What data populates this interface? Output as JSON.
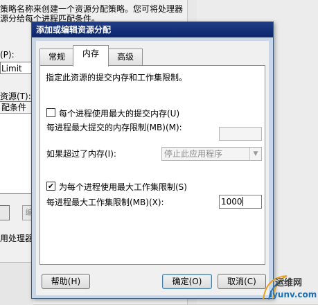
{
  "background_window": {
    "description_line1": "策略名称来创建一个资源分配策略。您可将处理器",
    "description_line2": "源分给每个进程匹配条件。",
    "field_label_fragment": "(P):",
    "field_value_fragment": "Limit",
    "resources_label_fragment": "资源(T):",
    "list_header_fragment": "配条件",
    "button_fragment": "编",
    "processor_fragment": "用处理器"
  },
  "dialog": {
    "title": "添加或编辑资源分配",
    "tabs": [
      {
        "label": "常规",
        "active": false
      },
      {
        "label": "内存",
        "active": true
      },
      {
        "label": "高级",
        "active": false
      }
    ],
    "panel": {
      "description": "指定此资源的提交内存和工作集限制。",
      "commit_memory": {
        "checkbox_label": "每个进程使用最大的提交内存(U)",
        "checked": false,
        "limit_label": "每进程最大提交的内存限制(MB)(M):",
        "limit_value": ""
      },
      "if_exceeded": {
        "label": "如果超过了内存(I):",
        "selected": "停止此应用程序"
      },
      "working_set": {
        "checkbox_label": "为每个进程使用最大工作集限制(S)",
        "checked": true,
        "checkmark": "✔",
        "limit_label": "每进程最大工作集限制(MB)(X):",
        "limit_value": "1000"
      }
    },
    "buttons": {
      "help": "帮助(H)",
      "ok": "确定(O)",
      "cancel": "取消(C)"
    }
  },
  "watermark": {
    "line1": "运维网",
    "line2": "iyunv.com"
  }
}
